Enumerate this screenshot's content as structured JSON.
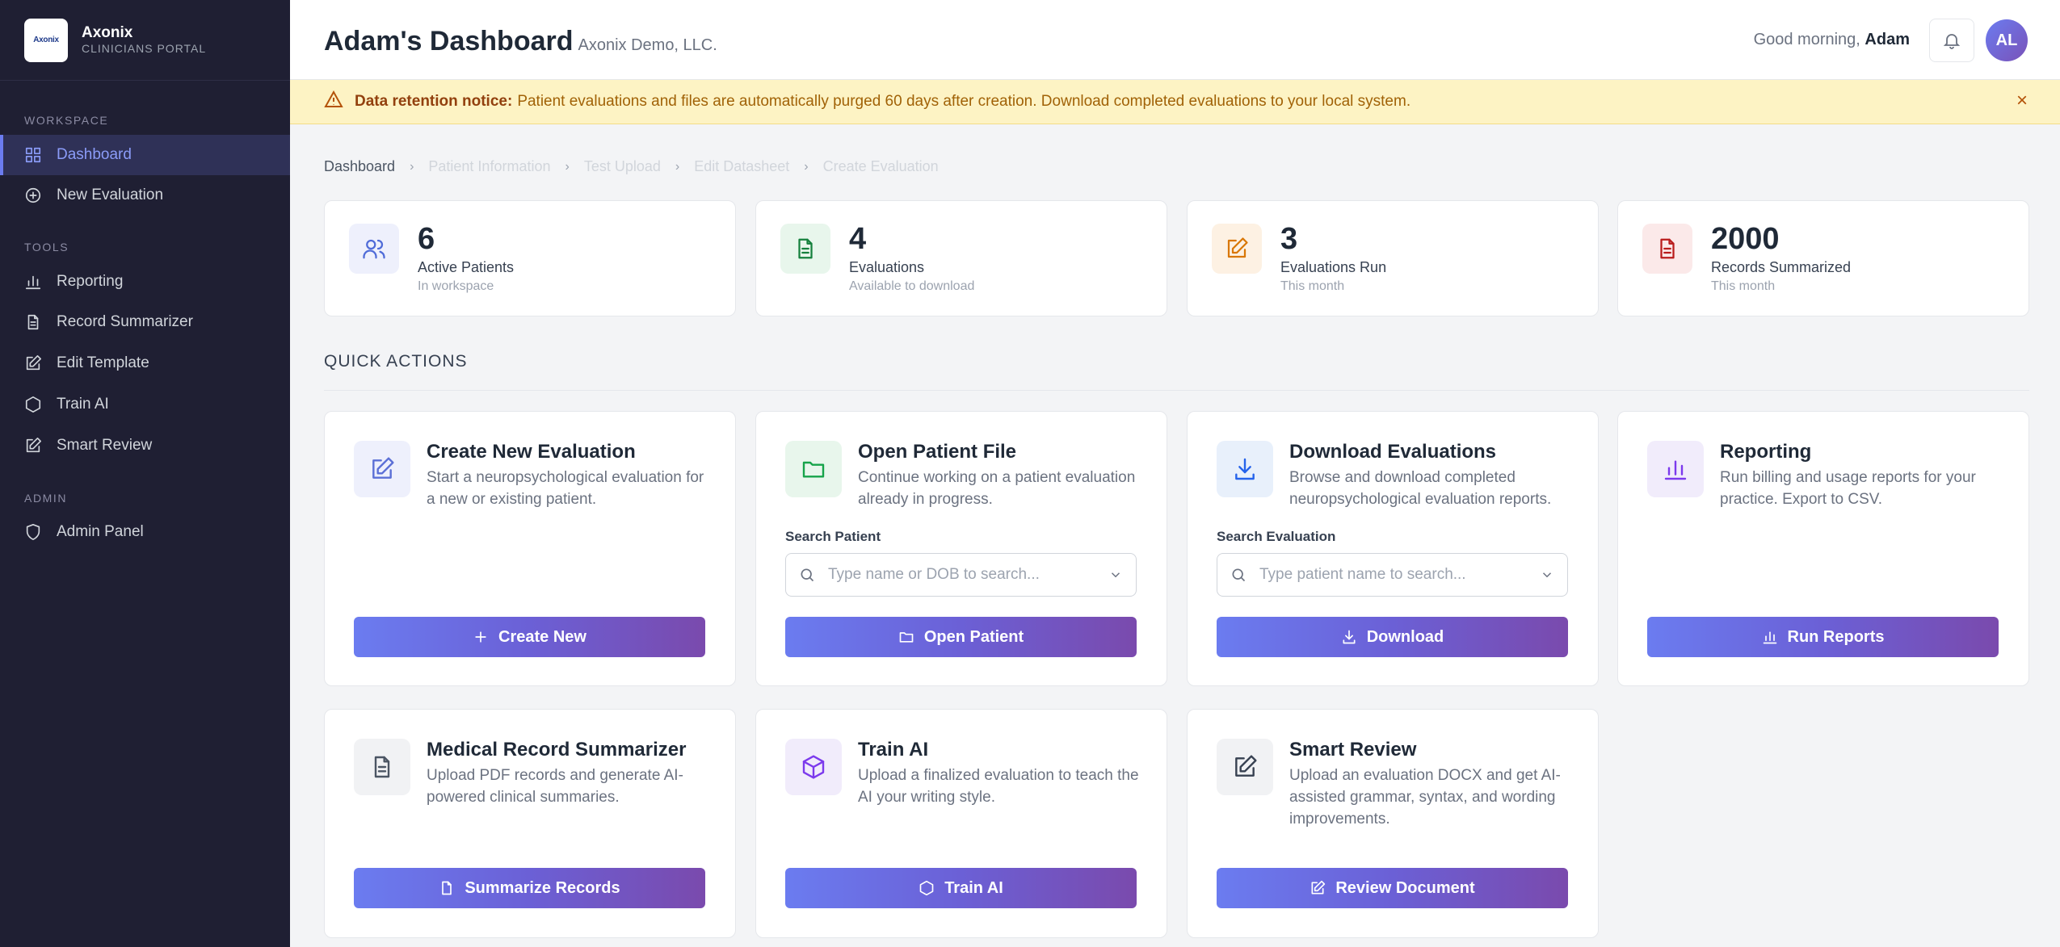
{
  "brand": {
    "logo_text": "Axonix",
    "name": "Axonix",
    "subtitle": "CLINICIANS PORTAL"
  },
  "sidebar": {
    "sections": [
      "WORKSPACE",
      "TOOLS",
      "ADMIN"
    ],
    "items": [
      {
        "label": "Dashboard",
        "icon": "grid-icon",
        "active": true
      },
      {
        "label": "New Evaluation",
        "icon": "plus-circle-icon"
      },
      {
        "label": "Reporting",
        "icon": "bar-chart-icon"
      },
      {
        "label": "Record Summarizer",
        "icon": "document-icon"
      },
      {
        "label": "Edit Template",
        "icon": "edit-icon"
      },
      {
        "label": "Train AI",
        "icon": "hexagon-icon"
      },
      {
        "label": "Smart Review",
        "icon": "edit-icon"
      },
      {
        "label": "Admin Panel",
        "icon": "shield-icon"
      }
    ]
  },
  "header": {
    "title": "Adam's Dashboard",
    "org": "Axonix Demo, LLC.",
    "greeting": "Good morning,",
    "user_name": "Adam",
    "avatar_initials": "AL"
  },
  "notice": {
    "title": "Data retention notice:",
    "text": "Patient evaluations and files are automatically purged 60 days after creation. Download completed evaluations to your local system.",
    "close": "×"
  },
  "breadcrumb": [
    "Dashboard",
    "Patient Information",
    "Test Upload",
    "Edit Datasheet",
    "Create Evaluation"
  ],
  "stats": [
    {
      "value": "6",
      "label": "Active Patients",
      "sub": "In workspace",
      "icon": "users-icon",
      "color": "#4f6bd8",
      "bg": "#eef0fc"
    },
    {
      "value": "4",
      "label": "Evaluations",
      "sub": "Available to download",
      "icon": "file-text-icon",
      "color": "#15803d",
      "bg": "#e8f6ec"
    },
    {
      "value": "3",
      "label": "Evaluations Run",
      "sub": "This month",
      "icon": "edit-icon",
      "color": "#d97706",
      "bg": "#fdf1e3"
    },
    {
      "value": "2000",
      "label": "Records Summarized",
      "sub": "This month",
      "icon": "file-text-icon",
      "color": "#b91c1c",
      "bg": "#fbe9e9"
    }
  ],
  "quick_actions_title": "QUICK ACTIONS",
  "actions": [
    {
      "title": "Create New Evaluation",
      "desc": "Start a neuropsychological evaluation for a new or existing patient.",
      "button": "Create New",
      "icon": "edit-icon",
      "btn_icon": "plus-icon",
      "color": "#5b6fd6",
      "bg": "#eef0fc"
    },
    {
      "title": "Open Patient File",
      "desc": "Continue working on a patient evaluation already in progress.",
      "field_label": "Search Patient",
      "placeholder": "Type name or DOB to search...",
      "button": "Open Patient",
      "icon": "folder-icon",
      "btn_icon": "folder-icon",
      "color": "#16a34a",
      "bg": "#e8f6ec"
    },
    {
      "title": "Download Evaluations",
      "desc": "Browse and download completed neuropsychological evaluation reports.",
      "field_label": "Search Evaluation",
      "placeholder": "Type patient name to search...",
      "button": "Download",
      "icon": "download-icon",
      "btn_icon": "download-icon",
      "color": "#2563eb",
      "bg": "#e8f0fb"
    },
    {
      "title": "Reporting",
      "desc": "Run billing and usage reports for your practice. Export to CSV.",
      "button": "Run Reports",
      "icon": "bar-chart-icon",
      "btn_icon": "bar-chart-icon",
      "color": "#7c3aed",
      "bg": "#f1ecfb"
    },
    {
      "title": "Medical Record Summarizer",
      "desc": "Upload PDF records and generate AI-powered clinical summaries.",
      "button": "Summarize Records",
      "icon": "file-text-icon",
      "btn_icon": "document-icon",
      "color": "#4b5563",
      "bg": "#f1f2f4"
    },
    {
      "title": "Train AI",
      "desc": "Upload a finalized evaluation to teach the AI your writing style.",
      "button": "Train AI",
      "icon": "cube-icon",
      "btn_icon": "hexagon-icon",
      "color": "#7c3aed",
      "bg": "#f1ecfb"
    },
    {
      "title": "Smart Review",
      "desc": "Upload an evaluation DOCX and get AI-assisted grammar, syntax, and wording improvements.",
      "button": "Review Document",
      "icon": "edit-icon",
      "btn_icon": "edit-icon",
      "color": "#374151",
      "bg": "#f1f2f4"
    }
  ]
}
